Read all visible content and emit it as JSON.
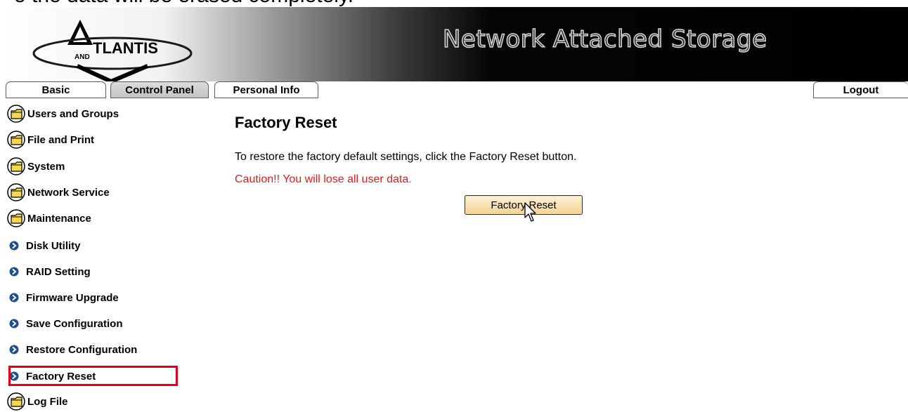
{
  "doc_caption": "o   the data will be erased completely.",
  "banner": {
    "logo_text": "TLANTIS",
    "logo_sub": "AND",
    "title": "Network Attached Storage"
  },
  "tabs": [
    {
      "label": "Basic",
      "active": false
    },
    {
      "label": "Control Panel",
      "active": true
    },
    {
      "label": "Personal Info",
      "active": false
    }
  ],
  "logout_label": "Logout",
  "sidebar": {
    "items": [
      {
        "label": "Users and Groups",
        "icon": "folder-icon"
      },
      {
        "label": "File and Print",
        "icon": "folder-icon"
      },
      {
        "label": "System",
        "icon": "folder-icon"
      },
      {
        "label": "Network Service",
        "icon": "folder-icon"
      },
      {
        "label": "Maintenance",
        "icon": "folder-icon"
      },
      {
        "label": "Disk Utility",
        "icon": "arrow-bullet-icon"
      },
      {
        "label": "RAID Setting",
        "icon": "arrow-bullet-icon"
      },
      {
        "label": "Firmware Upgrade",
        "icon": "arrow-bullet-icon"
      },
      {
        "label": "Save Configuration",
        "icon": "arrow-bullet-icon"
      },
      {
        "label": "Restore Configuration",
        "icon": "arrow-bullet-icon"
      },
      {
        "label": "Factory Reset",
        "icon": "arrow-bullet-icon",
        "selected": true
      },
      {
        "label": "Log File",
        "icon": "folder-icon"
      }
    ]
  },
  "main": {
    "title": "Factory Reset",
    "instruction": "To restore the factory default settings, click the Factory Reset button.",
    "caution": "Caution!! You will lose all user data.",
    "button_label": "Factory Reset"
  },
  "colors": {
    "caution": "#e21b1b",
    "highlight": "#e0001b",
    "bullet": "#1f4f8f"
  }
}
